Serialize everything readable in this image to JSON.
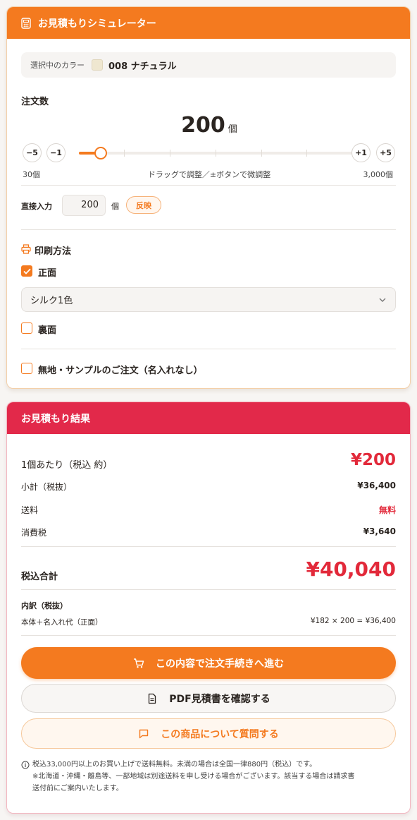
{
  "simulator": {
    "title": "お見積もりシミュレーター",
    "color": {
      "label": "選択中のカラー",
      "value": "008 ナチュラル",
      "swatch": "#efe7d0"
    },
    "quantity": {
      "title": "注文数",
      "value": "200",
      "unit": "個",
      "buttons": {
        "minus5": "−5",
        "minus1": "−1",
        "plus1": "+1",
        "plus5": "+5"
      },
      "slider_fraction": 0.057,
      "min_label": "30個",
      "hint": "ドラッグで調整／±ボタンで微調整",
      "max_label": "3,000個"
    },
    "direct_input": {
      "label": "直接入力",
      "value": "200",
      "unit": "個",
      "apply": "反映"
    },
    "print": {
      "title": "印刷方法",
      "front": {
        "label": "正面",
        "checked": true
      },
      "front_method": "シルク1色",
      "back": {
        "label": "裏面",
        "checked": false
      }
    },
    "plain_sample": {
      "label": "無地・サンプルのご注文（名入れなし）",
      "checked": false
    }
  },
  "result": {
    "title": "お見積もり結果",
    "unit_price_label": "1個あたり（税込 約）",
    "unit_price": "¥200",
    "subtotal_label": "小計（税抜）",
    "subtotal": "¥36,400",
    "shipping_label": "送料",
    "shipping": "無料",
    "tax_label": "消費税",
    "tax": "¥3,640",
    "total_label": "税込合計",
    "total": "¥40,040",
    "breakdown_title": "内訳（税抜）",
    "breakdown_item": "本体＋名入れ代（正面）",
    "breakdown_calc": "¥182 × 200 = ¥36,400",
    "order_button": "この内容で注文手続きへ進む",
    "pdf_button": "PDF見積書を確認する",
    "question_button": "この商品について質問する",
    "note_line1": "税込33,000円以上のお買い上げで送料無料。未満の場合は全国一律880円（税込）です。",
    "note_line2": "※北海道・沖縄・離島等、一部地域は別途送料を申し受ける場合がございます。該当する場合は請求書",
    "note_line3": "送付前にご案内いたします。"
  },
  "colors": {
    "accent": "#f47a1f",
    "result": "#e2294a",
    "price_red": "#e2293a"
  }
}
